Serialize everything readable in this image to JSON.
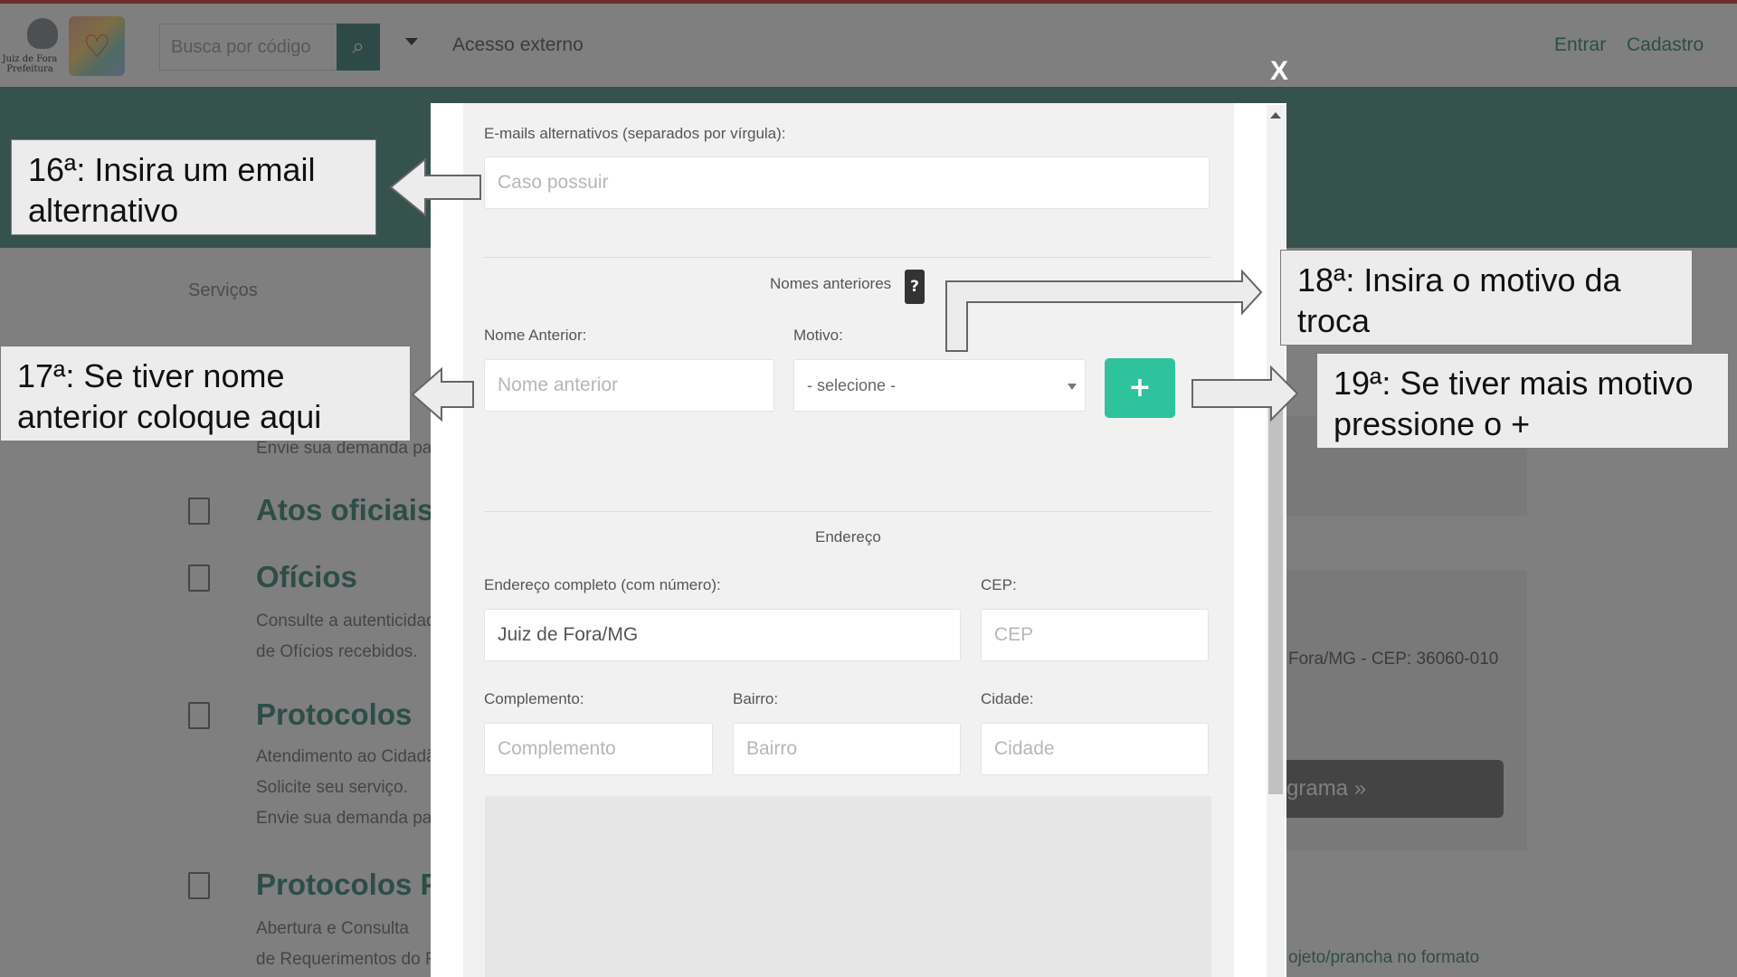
{
  "header": {
    "logo_text": "Juiz de Fora Prefeitura",
    "search_placeholder": "Busca por código",
    "external_access": "Acesso externo",
    "login": "Entrar",
    "register": "Cadastro"
  },
  "page": {
    "breadcrumb": "Serviços",
    "services": [
      {
        "title": "",
        "lines": [
          "Envie sua demanda pa"
        ]
      },
      {
        "title": "Atos oficiais",
        "lines": []
      },
      {
        "title": "Ofícios",
        "lines": [
          "Consulte a autenticidad",
          "de Ofícios recebidos."
        ]
      },
      {
        "title": "Protocolos",
        "lines": [
          "Atendimento ao Cidadã",
          "Solicite seu serviço.",
          "Envie sua demanda pa"
        ]
      },
      {
        "title": "Protocolos PR",
        "lines": [
          "Abertura e Consulta",
          "de Requerimentos do F"
        ]
      }
    ],
    "right_address": "Fora/MG - CEP: 36060-010",
    "right_button": "grama »",
    "right_link": "ojeto/prancha no formato"
  },
  "modal": {
    "close": "X",
    "alt_emails_label": "E-mails alternativos (separados por vírgula):",
    "alt_emails_placeholder": "Caso possuir",
    "previous_names_section": "Nomes anteriores",
    "help": "?",
    "previous_name_label": "Nome Anterior:",
    "previous_name_placeholder": "Nome anterior",
    "reason_label": "Motivo:",
    "reason_selected": "- selecione -",
    "add_button": "+",
    "address_section": "Endereço",
    "full_address_label": "Endereço completo (com número):",
    "full_address_value": "Juiz de Fora/MG",
    "cep_label": "CEP:",
    "cep_placeholder": "CEP",
    "complement_label": "Complemento:",
    "complement_placeholder": "Complemento",
    "district_label": "Bairro:",
    "district_placeholder": "Bairro",
    "city_label": "Cidade:",
    "city_placeholder": "Cidade"
  },
  "annotations": [
    "16ª: Insira um email alternativo",
    "17ª: Se tiver nome anterior coloque aqui",
    "18ª: Insira o motivo da troca",
    "19ª: Se tiver mais motivo pressione o +"
  ]
}
